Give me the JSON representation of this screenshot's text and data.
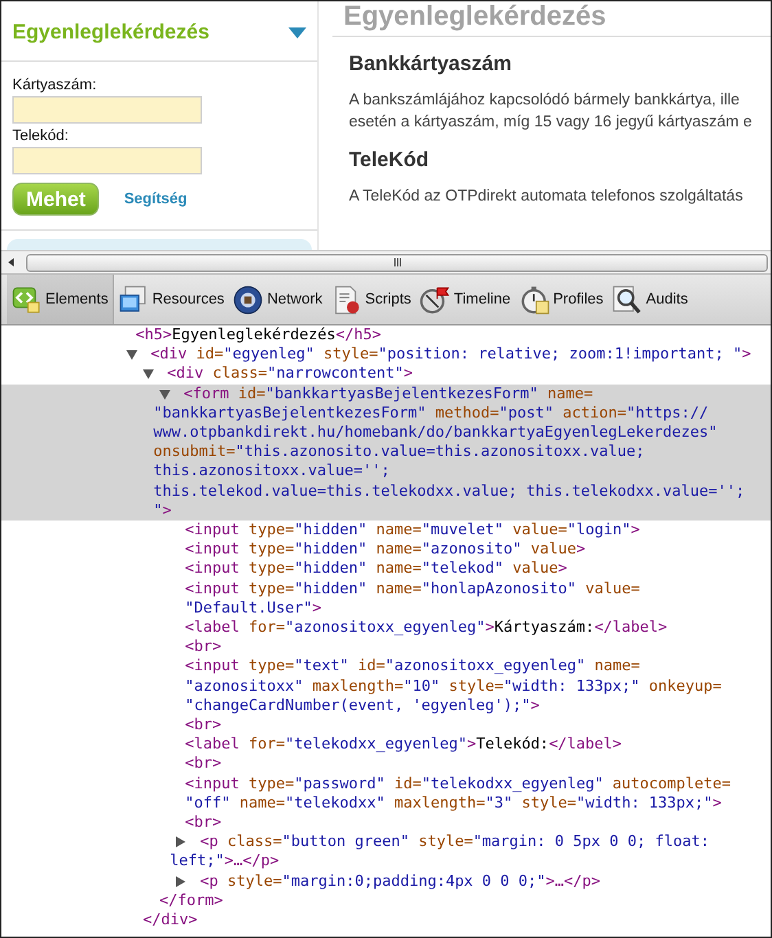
{
  "sidebar": {
    "title": "Egyenleglekérdezés",
    "fields": [
      {
        "label": "Kártyaszám:"
      },
      {
        "label": "Telekód:"
      }
    ],
    "submit": "Mehet",
    "help_link": "Segítség"
  },
  "article": {
    "title": "Egyenleglekérdezés",
    "sections": [
      {
        "heading": "Bankkártyaszám",
        "lines": [
          "A bankszámlájához kapcsolódó bármely bankkártya, ille",
          "esetén a kártyaszám, míg 15 vagy 16 jegyű kártyaszám e"
        ]
      },
      {
        "heading": "TeleKód",
        "lines": [
          "A TeleKód az OTPdirekt automata telefonos szolgáltatás"
        ]
      }
    ]
  },
  "devtools": {
    "tabs": [
      {
        "label": "Elements",
        "selected": true
      },
      {
        "label": "Resources",
        "selected": false
      },
      {
        "label": "Network",
        "selected": false
      },
      {
        "label": "Scripts",
        "selected": false
      },
      {
        "label": "Timeline",
        "selected": false
      },
      {
        "label": "Profiles",
        "selected": false
      },
      {
        "label": "Audits",
        "selected": false
      }
    ],
    "dom_tree": [
      {
        "selected": false,
        "lines": [
          [
            {
              "kind": "tag",
              "text": "<h5>"
            },
            {
              "kind": "text",
              "text": "Egyenleglekérdezés"
            },
            {
              "kind": "tag",
              "text": "</h5>"
            }
          ]
        ]
      },
      {
        "selected": false,
        "expanded": true,
        "lines": [
          [
            {
              "kind": "tag",
              "text": "<div"
            },
            {
              "kind": "attr",
              "text": " id="
            },
            {
              "kind": "value",
              "text": "\"egyenleg\""
            },
            {
              "kind": "attr",
              "text": " style="
            },
            {
              "kind": "value",
              "text": "\"position: relative; zoom:1!important; \""
            },
            {
              "kind": "tag",
              "text": ">"
            }
          ]
        ],
        "children": [
          {
            "selected": false,
            "expanded": true,
            "lines": [
              [
                {
                  "kind": "tag",
                  "text": "<div"
                },
                {
                  "kind": "attr",
                  "text": " class="
                },
                {
                  "kind": "value",
                  "text": "\"narrowcontent\""
                },
                {
                  "kind": "tag",
                  "text": ">"
                }
              ]
            ],
            "close": [
              {
                "kind": "tag",
                "text": "</div>"
              }
            ],
            "children": [
              {
                "selected": true,
                "expanded": true,
                "lines": [
                  [
                    {
                      "kind": "tag",
                      "text": "<form"
                    },
                    {
                      "kind": "attr",
                      "text": " id="
                    },
                    {
                      "kind": "value",
                      "text": "\"bankkartyasBejelentkezesForm\""
                    },
                    {
                      "kind": "attr",
                      "text": " name="
                    }
                  ],
                  [
                    {
                      "kind": "value",
                      "text": "\"bankkartyasBejelentkezesForm\""
                    },
                    {
                      "kind": "attr",
                      "text": " method="
                    },
                    {
                      "kind": "value",
                      "text": "\"post\""
                    },
                    {
                      "kind": "attr",
                      "text": " action="
                    },
                    {
                      "kind": "value",
                      "text": "\"https://"
                    }
                  ],
                  [
                    {
                      "kind": "value",
                      "text": "www.otpbankdirekt.hu/homebank/do/bankkartyaEgyenlegLekerdezes\""
                    }
                  ],
                  [
                    {
                      "kind": "attr",
                      "text": "onsubmit="
                    },
                    {
                      "kind": "value",
                      "text": "\"this.azonosito.value=this.azonositoxx.value;"
                    }
                  ],
                  [
                    {
                      "kind": "value",
                      "text": "this.azonositoxx.value='';"
                    }
                  ],
                  [
                    {
                      "kind": "value",
                      "text": "this.telekod.value=this.telekodxx.value; this.telekodxx.value='';"
                    }
                  ],
                  [
                    {
                      "kind": "value",
                      "text": "\""
                    },
                    {
                      "kind": "tag",
                      "text": ">"
                    }
                  ]
                ],
                "close": [
                  {
                    "kind": "tag",
                    "text": "</form>"
                  }
                ],
                "children": [
                  {
                    "selected": false,
                    "lines": [
                      [
                        {
                          "kind": "tag",
                          "text": "<input"
                        },
                        {
                          "kind": "attr",
                          "text": " type="
                        },
                        {
                          "kind": "value",
                          "text": "\"hidden\""
                        },
                        {
                          "kind": "attr",
                          "text": " name="
                        },
                        {
                          "kind": "value",
                          "text": "\"muvelet\""
                        },
                        {
                          "kind": "attr",
                          "text": " value="
                        },
                        {
                          "kind": "value",
                          "text": "\"login\""
                        },
                        {
                          "kind": "tag",
                          "text": ">"
                        }
                      ]
                    ]
                  },
                  {
                    "selected": false,
                    "lines": [
                      [
                        {
                          "kind": "tag",
                          "text": "<input"
                        },
                        {
                          "kind": "attr",
                          "text": " type="
                        },
                        {
                          "kind": "value",
                          "text": "\"hidden\""
                        },
                        {
                          "kind": "attr",
                          "text": " name="
                        },
                        {
                          "kind": "value",
                          "text": "\"azonosito\""
                        },
                        {
                          "kind": "attr",
                          "text": " value"
                        },
                        {
                          "kind": "tag",
                          "text": ">"
                        }
                      ]
                    ]
                  },
                  {
                    "selected": false,
                    "lines": [
                      [
                        {
                          "kind": "tag",
                          "text": "<input"
                        },
                        {
                          "kind": "attr",
                          "text": " type="
                        },
                        {
                          "kind": "value",
                          "text": "\"hidden\""
                        },
                        {
                          "kind": "attr",
                          "text": " name="
                        },
                        {
                          "kind": "value",
                          "text": "\"telekod\""
                        },
                        {
                          "kind": "attr",
                          "text": " value"
                        },
                        {
                          "kind": "tag",
                          "text": ">"
                        }
                      ]
                    ]
                  },
                  {
                    "selected": false,
                    "lines": [
                      [
                        {
                          "kind": "tag",
                          "text": "<input"
                        },
                        {
                          "kind": "attr",
                          "text": " type="
                        },
                        {
                          "kind": "value",
                          "text": "\"hidden\""
                        },
                        {
                          "kind": "attr",
                          "text": " name="
                        },
                        {
                          "kind": "value",
                          "text": "\"honlapAzonosito\""
                        },
                        {
                          "kind": "attr",
                          "text": " value="
                        }
                      ],
                      [
                        {
                          "kind": "value",
                          "text": "\"Default.User\""
                        },
                        {
                          "kind": "tag",
                          "text": ">"
                        }
                      ]
                    ]
                  },
                  {
                    "selected": false,
                    "lines": [
                      [
                        {
                          "kind": "tag",
                          "text": "<label"
                        },
                        {
                          "kind": "attr",
                          "text": " for="
                        },
                        {
                          "kind": "value",
                          "text": "\"azonositoxx_egyenleg\""
                        },
                        {
                          "kind": "tag",
                          "text": ">"
                        },
                        {
                          "kind": "text",
                          "text": "Kártyaszám:"
                        },
                        {
                          "kind": "tag",
                          "text": "</label>"
                        }
                      ]
                    ]
                  },
                  {
                    "selected": false,
                    "lines": [
                      [
                        {
                          "kind": "tag",
                          "text": "<br>"
                        }
                      ]
                    ]
                  },
                  {
                    "selected": false,
                    "lines": [
                      [
                        {
                          "kind": "tag",
                          "text": "<input"
                        },
                        {
                          "kind": "attr",
                          "text": " type="
                        },
                        {
                          "kind": "value",
                          "text": "\"text\""
                        },
                        {
                          "kind": "attr",
                          "text": " id="
                        },
                        {
                          "kind": "value",
                          "text": "\"azonositoxx_egyenleg\""
                        },
                        {
                          "kind": "attr",
                          "text": " name="
                        }
                      ],
                      [
                        {
                          "kind": "value",
                          "text": "\"azonositoxx\""
                        },
                        {
                          "kind": "attr",
                          "text": " maxlength="
                        },
                        {
                          "kind": "value",
                          "text": "\"10\""
                        },
                        {
                          "kind": "attr",
                          "text": " style="
                        },
                        {
                          "kind": "value",
                          "text": "\"width: 133px;\""
                        },
                        {
                          "kind": "attr",
                          "text": " onkeyup="
                        }
                      ],
                      [
                        {
                          "kind": "value",
                          "text": "\"changeCardNumber(event, 'egyenleg');\""
                        },
                        {
                          "kind": "tag",
                          "text": ">"
                        }
                      ]
                    ]
                  },
                  {
                    "selected": false,
                    "lines": [
                      [
                        {
                          "kind": "tag",
                          "text": "<br>"
                        }
                      ]
                    ]
                  },
                  {
                    "selected": false,
                    "lines": [
                      [
                        {
                          "kind": "tag",
                          "text": "<label"
                        },
                        {
                          "kind": "attr",
                          "text": " for="
                        },
                        {
                          "kind": "value",
                          "text": "\"telekodxx_egyenleg\""
                        },
                        {
                          "kind": "tag",
                          "text": ">"
                        },
                        {
                          "kind": "text",
                          "text": "Telekód:"
                        },
                        {
                          "kind": "tag",
                          "text": "</label>"
                        }
                      ]
                    ]
                  },
                  {
                    "selected": false,
                    "lines": [
                      [
                        {
                          "kind": "tag",
                          "text": "<br>"
                        }
                      ]
                    ]
                  },
                  {
                    "selected": false,
                    "lines": [
                      [
                        {
                          "kind": "tag",
                          "text": "<input"
                        },
                        {
                          "kind": "attr",
                          "text": " type="
                        },
                        {
                          "kind": "value",
                          "text": "\"password\""
                        },
                        {
                          "kind": "attr",
                          "text": " id="
                        },
                        {
                          "kind": "value",
                          "text": "\"telekodxx_egyenleg\""
                        },
                        {
                          "kind": "attr",
                          "text": " autocomplete="
                        }
                      ],
                      [
                        {
                          "kind": "value",
                          "text": "\"off\""
                        },
                        {
                          "kind": "attr",
                          "text": " name="
                        },
                        {
                          "kind": "value",
                          "text": "\"telekodxx\""
                        },
                        {
                          "kind": "attr",
                          "text": " maxlength="
                        },
                        {
                          "kind": "value",
                          "text": "\"3\""
                        },
                        {
                          "kind": "attr",
                          "text": " style="
                        },
                        {
                          "kind": "value",
                          "text": "\"width: 133px;\""
                        },
                        {
                          "kind": "tag",
                          "text": ">"
                        }
                      ]
                    ]
                  },
                  {
                    "selected": false,
                    "lines": [
                      [
                        {
                          "kind": "tag",
                          "text": "<br>"
                        }
                      ]
                    ]
                  },
                  {
                    "selected": false,
                    "expanded": false,
                    "lines": [
                      [
                        {
                          "kind": "tag",
                          "text": "<p"
                        },
                        {
                          "kind": "attr",
                          "text": " class="
                        },
                        {
                          "kind": "value",
                          "text": "\"button green\""
                        },
                        {
                          "kind": "attr",
                          "text": " style="
                        },
                        {
                          "kind": "value",
                          "text": "\"margin: 0 5px 0 0; float:"
                        }
                      ],
                      [
                        {
                          "kind": "value",
                          "text": "left;\""
                        },
                        {
                          "kind": "tag",
                          "text": ">…</p>"
                        }
                      ]
                    ]
                  },
                  {
                    "selected": false,
                    "expanded": false,
                    "lines": [
                      [
                        {
                          "kind": "tag",
                          "text": "<p"
                        },
                        {
                          "kind": "attr",
                          "text": " style="
                        },
                        {
                          "kind": "value",
                          "text": "\"margin:0;padding:4px 0 0 0;\""
                        },
                        {
                          "kind": "tag",
                          "text": ">…</p>"
                        }
                      ]
                    ]
                  }
                ]
              }
            ]
          }
        ]
      }
    ]
  }
}
